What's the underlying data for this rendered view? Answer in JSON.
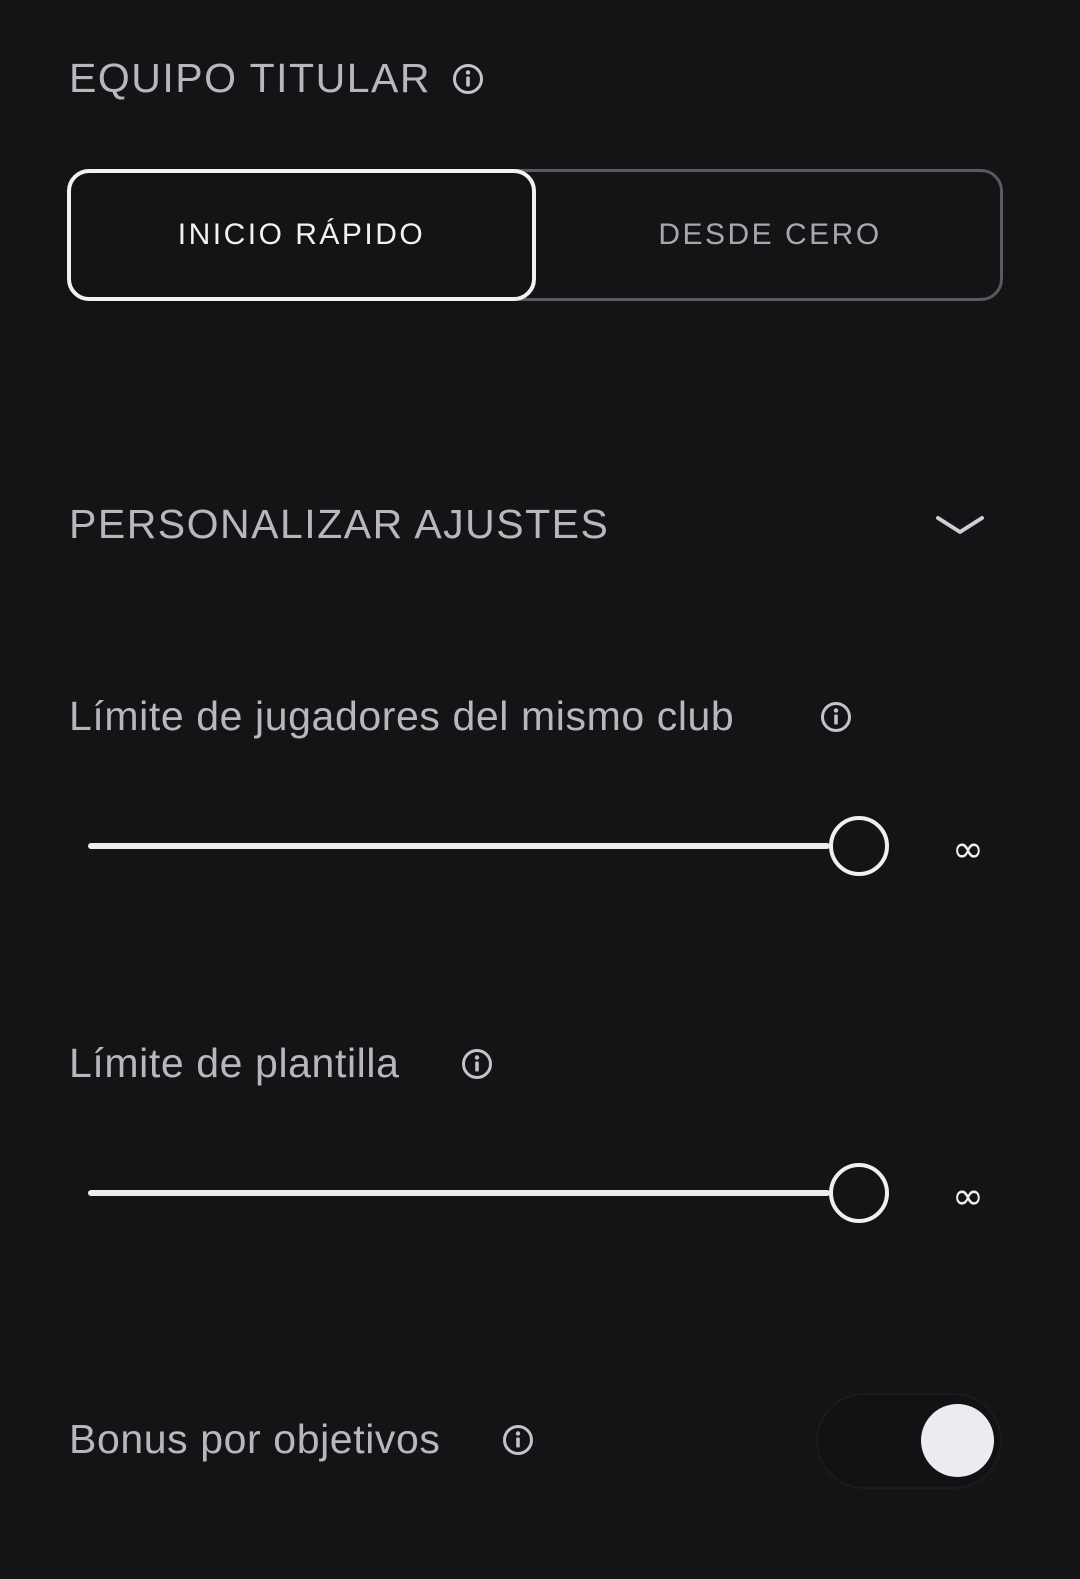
{
  "team_section": {
    "title": "EQUIPO TITULAR",
    "options": [
      {
        "label": "INICIO RÁPIDO",
        "selected": true
      },
      {
        "label": "DESDE CERO",
        "selected": false
      }
    ]
  },
  "settings_section": {
    "title": "PERSONALIZAR AJUSTES",
    "expand_icon": "chevron-down-icon",
    "club_limit": {
      "label": "Límite de jugadores del mismo club",
      "value_label": "∞",
      "slider_fraction": 1.0
    },
    "squad_limit": {
      "label": "Límite de plantilla",
      "value_label": "∞",
      "slider_fraction": 1.0
    },
    "goal_bonus": {
      "label": "Bonus por objetivos",
      "enabled": true
    }
  },
  "colors": {
    "background": "#141416",
    "text": "#b8b8bc",
    "active": "#f2f2f4"
  }
}
